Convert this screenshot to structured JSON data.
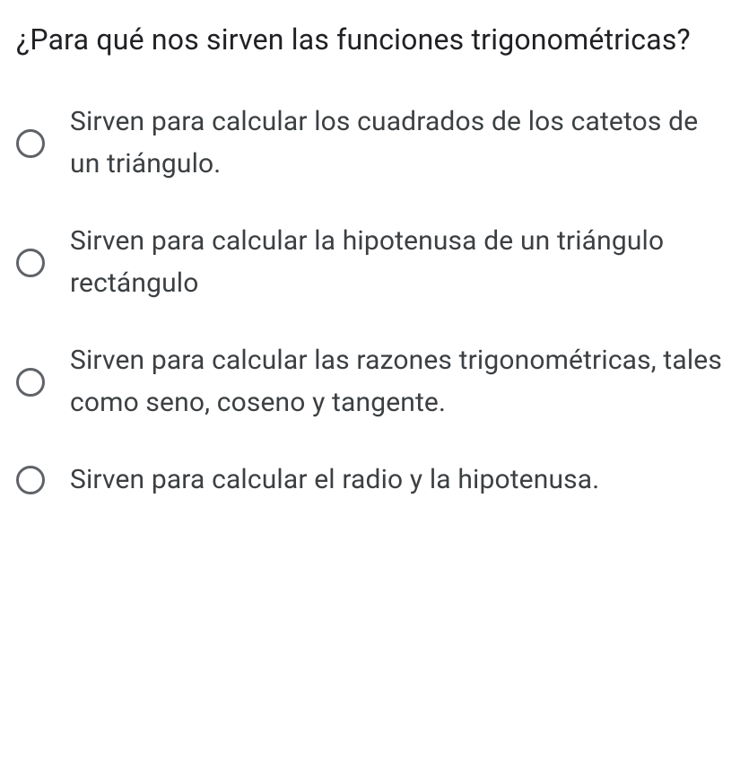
{
  "question": {
    "title": "¿Para qué nos sirven las funciones trigonométricas?"
  },
  "options": [
    {
      "label": "Sirven para calcular los cuadrados de los catetos de un triángulo."
    },
    {
      "label": "Sirven para calcular la hipotenusa de un triángulo rectángulo"
    },
    {
      "label": "Sirven para calcular las razones trigonométricas, tales como seno, coseno y tangente."
    },
    {
      "label": "Sirven para calcular el radio y la hipotenusa."
    }
  ]
}
